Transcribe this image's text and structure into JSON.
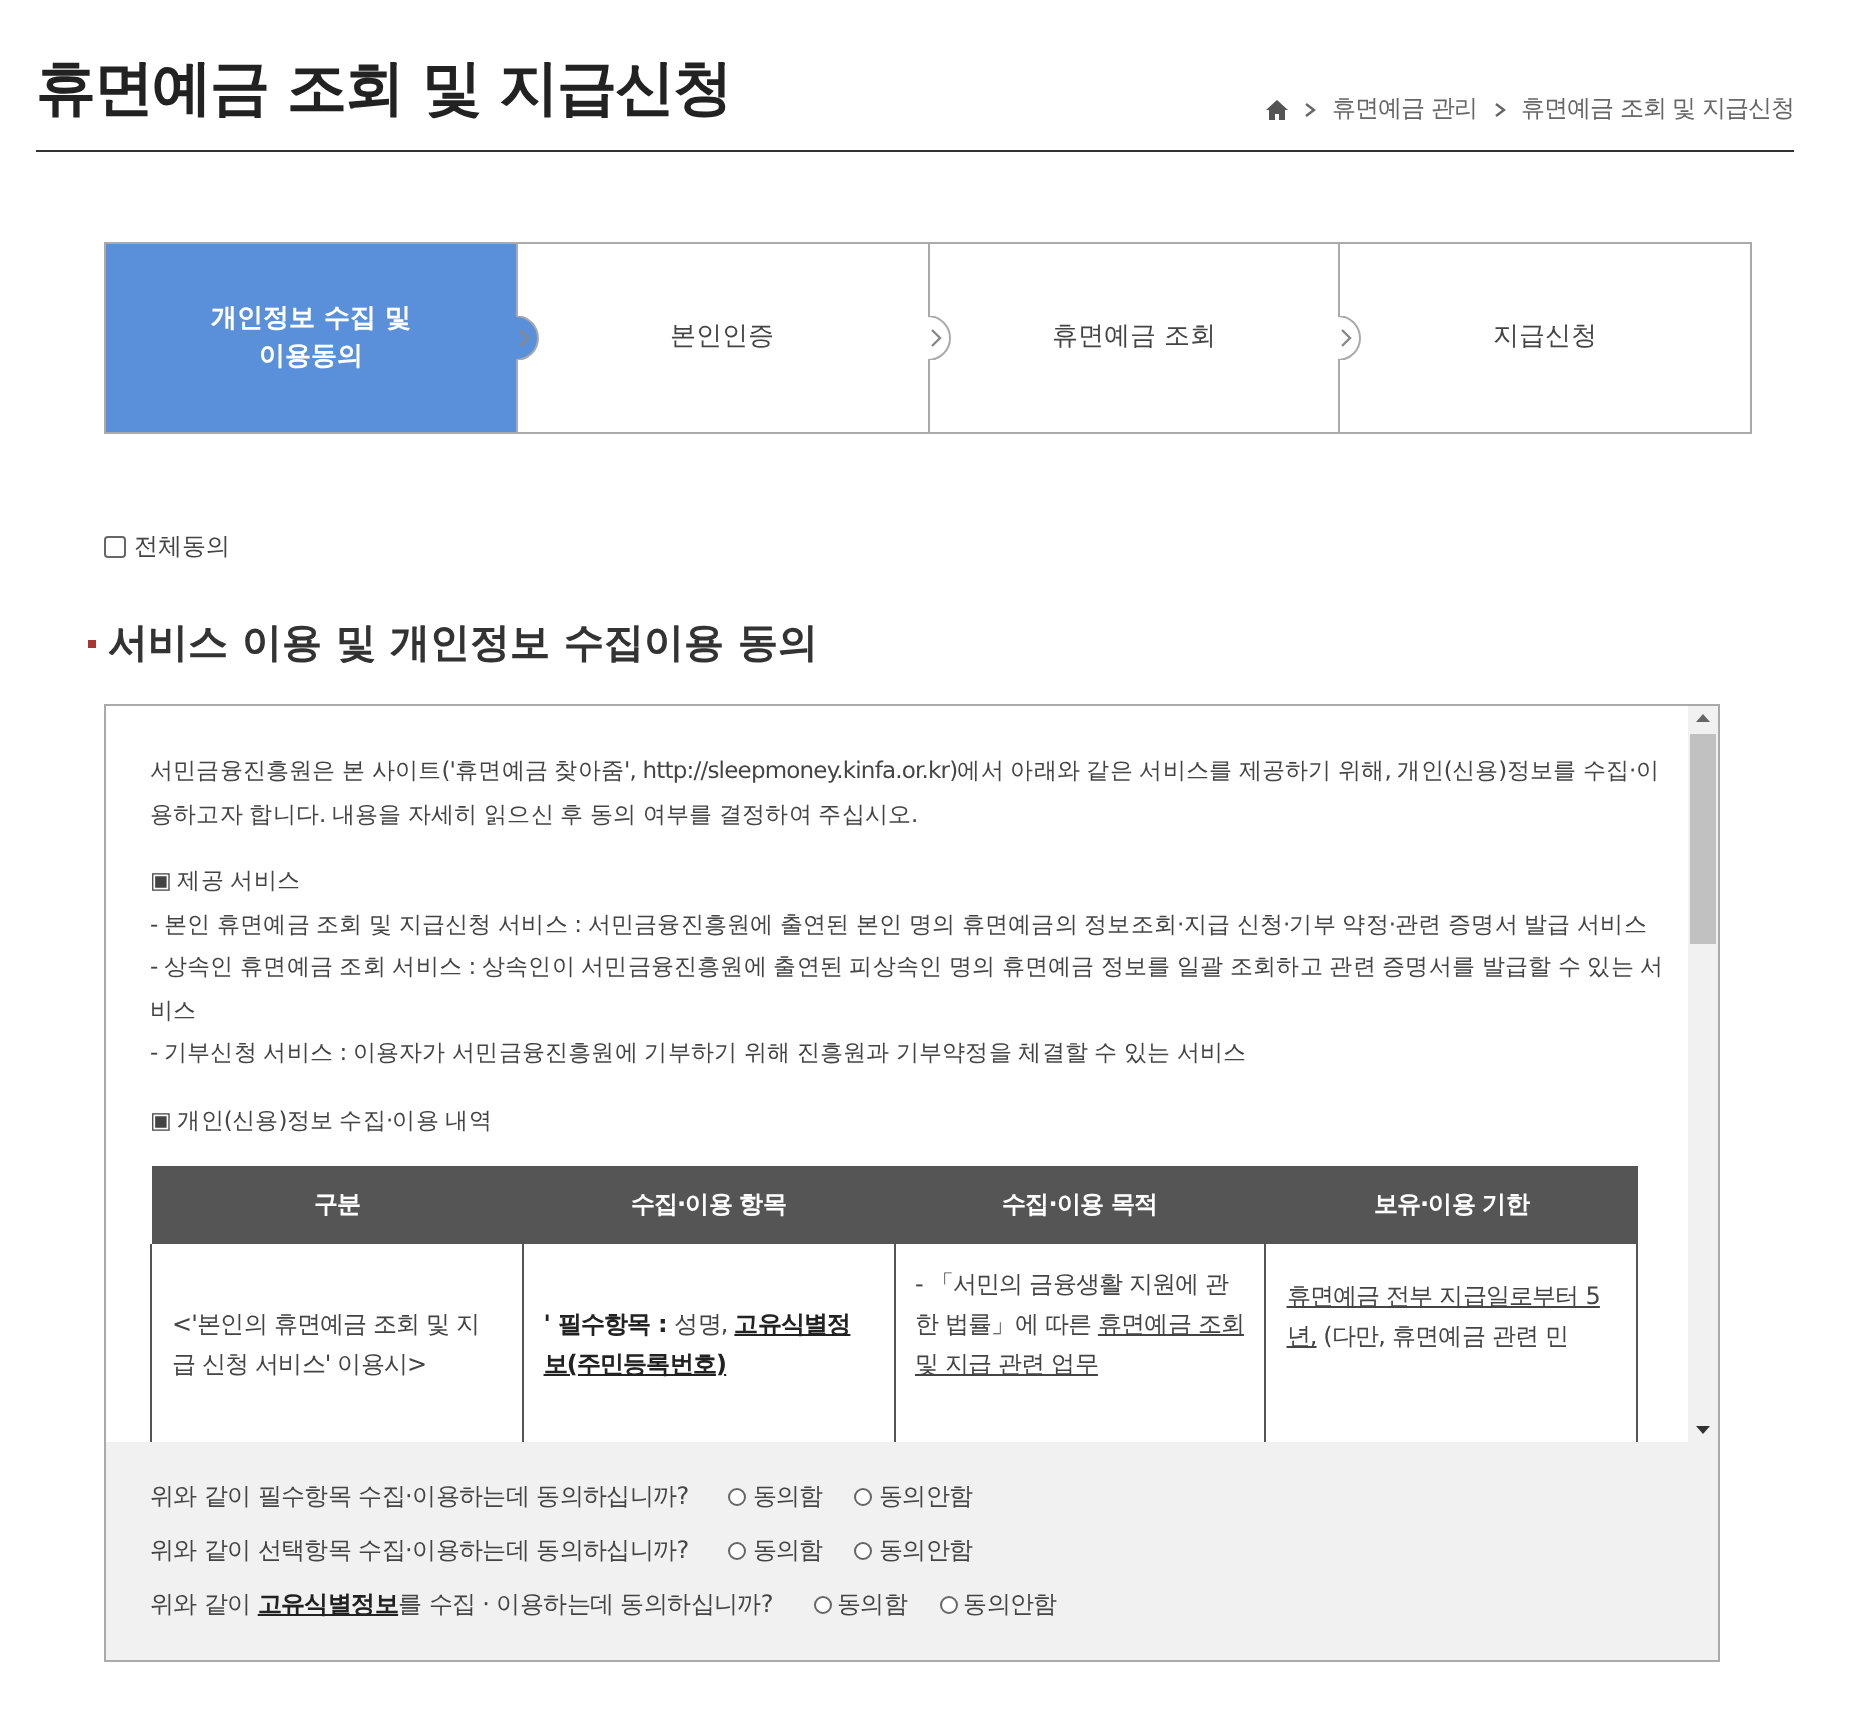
{
  "page": {
    "title": "휴면예금 조회 및 지급신청"
  },
  "breadcrumb": [
    "휴면예금 관리",
    "휴면예금 조회 및 지급신청"
  ],
  "steps": [
    {
      "label": "개인정보 수집 및\n이용동의",
      "selected": true
    },
    {
      "label": "본인인증",
      "selected": false
    },
    {
      "label": "휴면예금 조회",
      "selected": false
    },
    {
      "label": "지급신청",
      "selected": false
    }
  ],
  "agree_all": {
    "label": "전체동의",
    "checked": false
  },
  "section": {
    "title": "서비스 이용 및 개인정보 수집이용 동의"
  },
  "terms": {
    "intro": "서민금융진흥원은 본 사이트('휴면예금 찾아줌', http://sleepmoney.kinfa.or.kr)에서 아래와 같은 서비스를 제공하기 위해, 개인(신용)정보를 수집·이용하고자 합니다. 내용을 자세히 읽으신 후 동의 여부를 결정하여 주십시오.",
    "blocks": [
      {
        "heading": "▣ 제공 서비스",
        "lines": [
          "- 본인 휴면예금 조회 및 지급신청 서비스 : 서민금융진흥원에 출연된 본인 명의 휴면예금의 정보조회·지급 신청·기부 약정·관련 증명서 발급 서비스",
          "- 상속인 휴면예금 조회 서비스 : 상속인이 서민금융진흥원에 출연된 피상속인 명의 휴면예금 정보를 일괄 조회하고 관련 증명서를 발급할 수 있는 서비스",
          "- 기부신청 서비스 : 이용자가 서민금융진흥원에 기부하기 위해 진흥원과 기부약정을 체결할 수 있는 서비스"
        ]
      },
      {
        "heading": "▣ 개인(신용)정보 수집·이용 내역"
      }
    ],
    "table": {
      "columns": [
        "구분",
        "수집·이용 항목",
        "수집·이용 목적",
        "보유·이용 기한"
      ],
      "rows": [
        [
          [
            {
              "text": "<'본인의 휴면예금 조회 및 지급 신청 서비스' 이용시>",
              "bold": false,
              "underline": false
            }
          ],
          [
            {
              "text": "' 필수항목 : ",
              "bold": true,
              "underline": false
            },
            {
              "text": "성명, ",
              "bold": false,
              "underline": false
            },
            {
              "text": "고유식별정보(주민등록번호)",
              "bold": true,
              "underline": true
            }
          ],
          [
            {
              "text": "- 「서민의 금융생활 지원에 관한 법률」에 따른 ",
              "bold": false,
              "underline": false
            },
            {
              "text": "휴면예금 조회 및 지급 관련 업무",
              "bold": false,
              "underline": true
            }
          ],
          [
            {
              "text": "휴면예금 전부 지급일로부터 5년,",
              "bold": false,
              "underline": true
            },
            {
              "text": " (다만, 휴면예금 관련 민",
              "bold": false,
              "underline": false
            }
          ]
        ]
      ]
    }
  },
  "questions": [
    {
      "text": [
        {
          "text": "위와 같이 필수항목 수집·이용하는데 동의하십니까?",
          "bold": false,
          "underline": false
        }
      ],
      "options": [
        {
          "label": "동의함",
          "selected": false
        },
        {
          "label": "동의안함",
          "selected": false
        }
      ]
    },
    {
      "text": [
        {
          "text": "위와 같이 선택항목 수집·이용하는데 동의하십니까?",
          "bold": false,
          "underline": false
        }
      ],
      "options": [
        {
          "label": "동의함",
          "selected": false
        },
        {
          "label": "동의안함",
          "selected": false
        }
      ]
    },
    {
      "text": [
        {
          "text": "위와 같이 ",
          "bold": false,
          "underline": false
        },
        {
          "text": "고유식별정보",
          "bold": true,
          "underline": true
        },
        {
          "text": "를 수집 · 이용하는데 동의하십니까?",
          "bold": false,
          "underline": false
        }
      ],
      "options": [
        {
          "label": "동의함",
          "selected": false
        },
        {
          "label": "동의안함",
          "selected": false
        }
      ]
    }
  ]
}
